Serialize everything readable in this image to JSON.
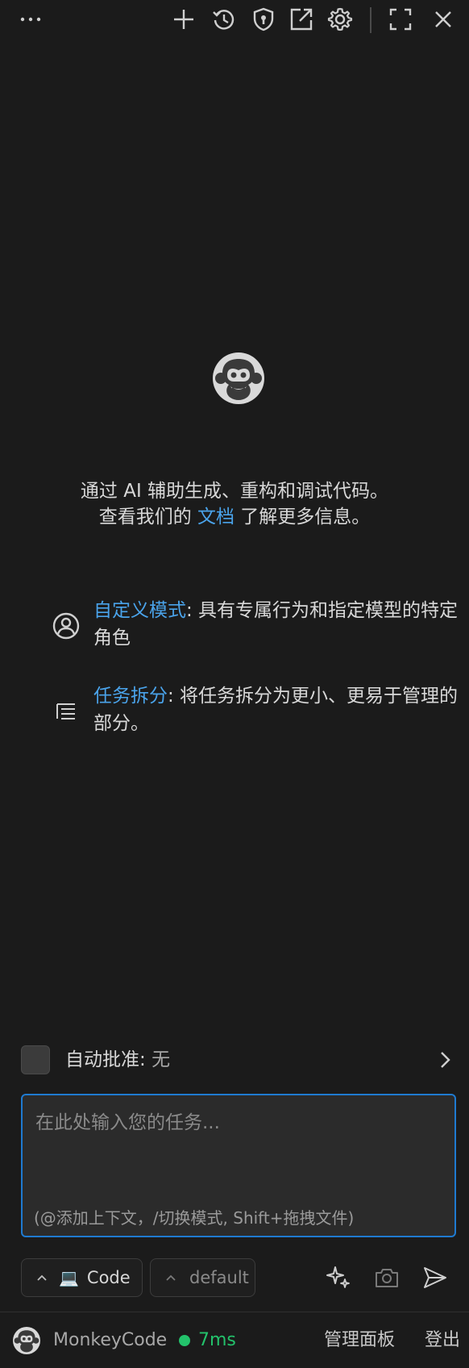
{
  "toolbar": {
    "icons": [
      "more-icon",
      "plus-icon",
      "history-icon",
      "shield-icon",
      "external-link-icon",
      "gear-icon",
      "fullscreen-icon",
      "close-icon"
    ],
    "more_label": "···"
  },
  "welcome": {
    "line1": "通过 AI 辅助生成、重构和调试代码。",
    "line2_prefix": "查看我们的 ",
    "line2_link": "文档",
    "line2_suffix": " 了解更多信息。",
    "features": [
      {
        "icon": "user-circle-icon",
        "title": "自定义模式",
        "text": ": 具有专属行为和指定模型的特定角色"
      },
      {
        "icon": "task-list-icon",
        "title": "任务拆分",
        "text": ": 将任务拆分为更小、更易于管理的部分。"
      }
    ]
  },
  "auto_approve": {
    "label": "自动批准",
    "separator": ": ",
    "value": "无",
    "checked": false
  },
  "input": {
    "value": "",
    "placeholder": "在此处输入您的任务...",
    "hint": "(@添加上下文，/切换模式, Shift+拖拽文件)"
  },
  "controls": {
    "mode_emoji": "💻",
    "mode_label": "Code",
    "profile_label": "default",
    "icons": [
      "sparkle-icon",
      "camera-icon",
      "send-icon"
    ]
  },
  "status": {
    "app_name": "MonkeyCode",
    "latency": "7ms",
    "latency_color": "#23c26b",
    "admin_label": "管理面板",
    "logout_label": "登出"
  },
  "colors": {
    "background": "#1b1b1b",
    "accent": "#4aa3ea",
    "input_border": "#1f7ad0"
  }
}
